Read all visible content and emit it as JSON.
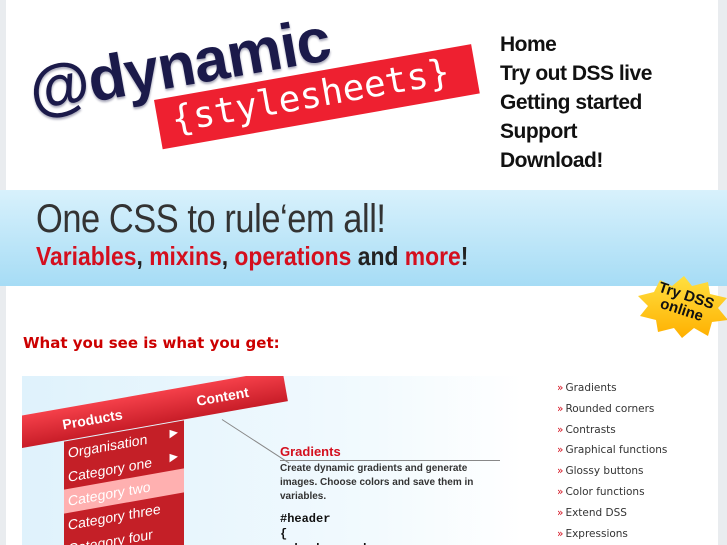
{
  "logo": {
    "text": "@dynamic",
    "tape": "{stylesheets}"
  },
  "nav": [
    "Home",
    "Try out DSS live",
    "Getting started",
    "Support",
    "Download!"
  ],
  "banner": {
    "headline": "One CSS to rule‘em all!",
    "sub": [
      {
        "text": "Variables",
        "red": true
      },
      {
        "text": ", ",
        "red": false
      },
      {
        "text": "mixins",
        "red": true
      },
      {
        "text": ", ",
        "red": false
      },
      {
        "text": "operations",
        "red": true
      },
      {
        "text": " and ",
        "red": false
      },
      {
        "text": "more",
        "red": true
      },
      {
        "text": "!",
        "red": false
      }
    ]
  },
  "badge": {
    "text": "Try DSS online",
    "color": "#ffcc00"
  },
  "subhead": "What you see is what you get:",
  "illustration": {
    "bar": [
      "Products",
      "Content"
    ],
    "menu": [
      "Organisation",
      "Category one",
      "Category two",
      "Category three",
      "Category four"
    ],
    "callout_title": "Gradients",
    "callout_desc": "Create dynamic gradients and generate images. Choose colors and save them in variables.",
    "code": "#header\n{\n  background:"
  },
  "features": [
    "Gradients",
    "Rounded corners",
    "Contrasts",
    "Graphical functions",
    "Glossy buttons",
    "Color functions",
    "Extend DSS",
    "Expressions"
  ],
  "colors": {
    "accent": "#d40f1e",
    "navy": "#1b1a4a",
    "band": "#a6dcf5"
  }
}
